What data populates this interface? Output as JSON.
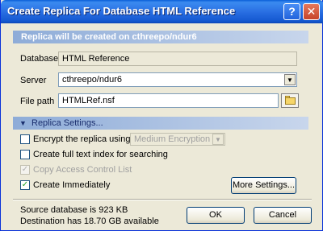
{
  "window": {
    "title": "Create Replica For Database HTML Reference",
    "help_label": "?",
    "close_label": "✕"
  },
  "banner": {
    "text": "Replica will be created on cthreepo/ndur6"
  },
  "form": {
    "database_label": "Database",
    "database_value": "HTML Reference",
    "server_label": "Server",
    "server_value": "cthreepo/ndur6",
    "filepath_label": "File path",
    "filepath_value": "HTMLRef.nsf"
  },
  "settings": {
    "header": "Replica Settings...",
    "encrypt_label": "Encrypt the replica using",
    "encrypt_checked": false,
    "encryption_option": "Medium Encryption",
    "fulltext_label": "Create full text index for searching",
    "fulltext_checked": false,
    "acl_label": "Copy Access Control List",
    "acl_checked": true,
    "immediate_label": "Create Immediately",
    "immediate_checked": true,
    "more_button": "More Settings..."
  },
  "footer": {
    "source_size": "Source database is 923 KB",
    "destination_space": "Destination has 18.70 GB available",
    "ok_button": "OK",
    "cancel_button": "Cancel"
  },
  "icons": {
    "dropdown": "chevron-down-icon",
    "folder": "folder-icon",
    "expand": "triangle-down-icon",
    "check": "checkmark-icon"
  }
}
